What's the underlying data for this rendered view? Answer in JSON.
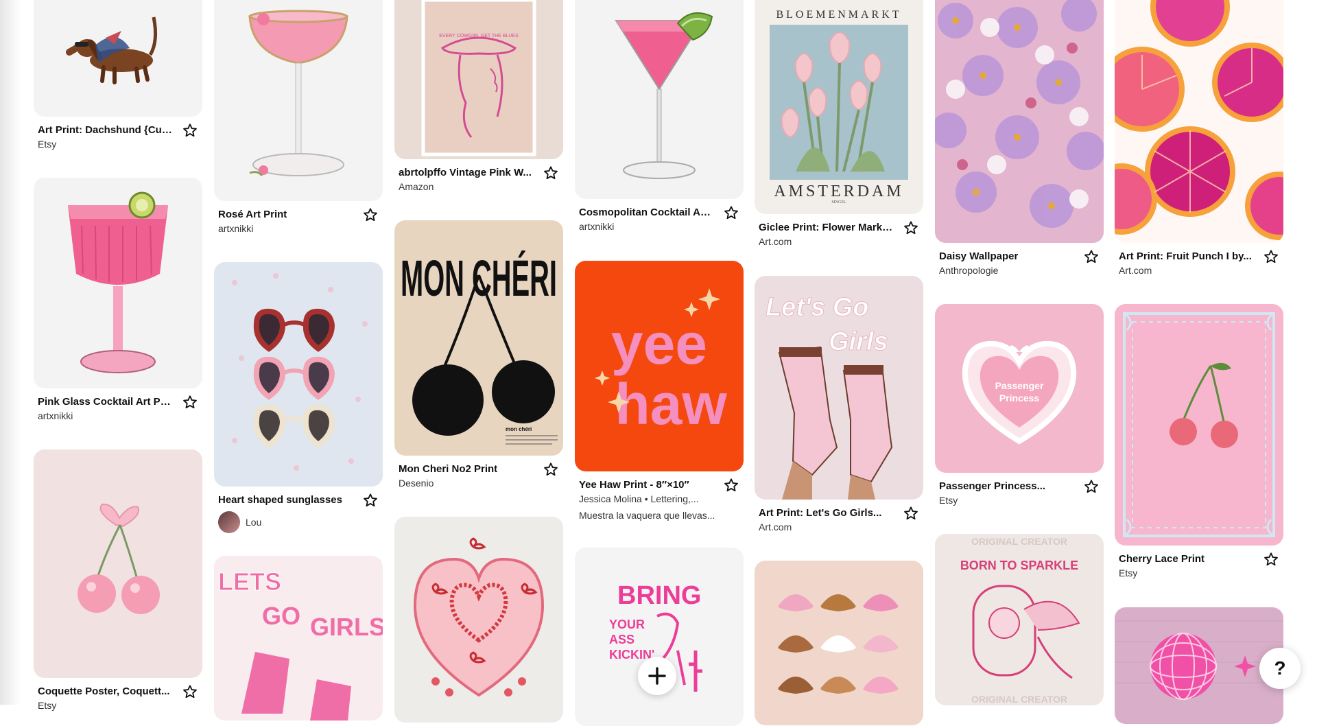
{
  "pins": {
    "c1": [
      {
        "title": "Art Print: Dachshund {Cut...",
        "source": "Etsy",
        "icon": "dachshund-illustration"
      },
      {
        "title": "Pink Glass Cocktail Art Print",
        "source": "artxnikki",
        "icon": "pink-cocktail-glass"
      },
      {
        "title": "Coquette Poster, Coquett...",
        "source": "Etsy",
        "icon": "pink-cherry-bow"
      }
    ],
    "c2": [
      {
        "title": "Rosé Art Print",
        "source": "artxnikki",
        "icon": "rose-coupe-glass"
      },
      {
        "title": "Heart shaped sunglasses",
        "creator": "Lou",
        "icon": "heart-sunglasses"
      },
      {
        "art_text": "LETS GO GIRLS",
        "icon": "lets-go-girls-boots"
      }
    ],
    "c3": [
      {
        "title": "abrtolpffo Vintage Pink W...",
        "source": "Amazon",
        "art_text": "EVERY COWGIRL GET THE BLUES",
        "icon": "cowgirl-poster"
      },
      {
        "title": "Mon Cheri No2 Print",
        "source": "Desenio",
        "art_text": "MON CHÉRI",
        "art_caption": "mon chéri",
        "icon": "mon-cheri-cherries"
      },
      {
        "icon": "heart-cake"
      }
    ],
    "c4": [
      {
        "title": "Cosmopolitan Cocktail Art...",
        "source": "artxnikki",
        "icon": "cosmopolitan-glass"
      },
      {
        "title": "Yee Haw Print - 8″×10″",
        "source": "Jessica Molina • Lettering,...",
        "description": "Muestra la vaquera que llevas...",
        "art_text": "yee haw",
        "icon": "yee-haw-lettering"
      },
      {
        "art_text": "BRING YOUR ASS KICKIN'",
        "icon": "bring-cowgirl"
      }
    ],
    "c5": [
      {
        "title": "Giclee Print: Flower Marke...",
        "source": "Art.com",
        "art_top": "BLOEMENMARKT",
        "art_bottom": "AMSTERDAM",
        "art_small": "SINGEL",
        "icon": "tulips-poster"
      },
      {
        "title": "Art Print: Let's Go Girls...",
        "source": "Art.com",
        "art_text": "Let's Go Girls",
        "icon": "cowboy-boots"
      },
      {
        "icon": "cowboy-hats"
      }
    ],
    "c6": [
      {
        "title": "Daisy Wallpaper",
        "source": "Anthropologie",
        "icon": "daisy-pattern"
      },
      {
        "title": "Passenger Princess...",
        "source": "Etsy",
        "art_text": "Passenger Princess",
        "icon": "heart-cake-princess"
      },
      {
        "art_text": "BORN TO SPARKLE",
        "watermark": "ORIGINAL CREATOR",
        "icon": "sparkle-cowgirl"
      }
    ],
    "c7": [
      {
        "title": "Art Print: Fruit Punch I by...",
        "source": "Art.com",
        "icon": "grapefruit-slices"
      },
      {
        "title": "Cherry Lace Print",
        "source": "Etsy",
        "icon": "cherry-lace"
      },
      {
        "icon": "disco-ball"
      }
    ]
  },
  "controls": {
    "add_icon": "plus-icon",
    "help_label": "?",
    "save_icon": "star-outline-icon"
  },
  "colors": {
    "accent_pink": "#f06ea8",
    "yeehaw_orange": "#f4480f",
    "tile_bg": "#f2f2f2"
  }
}
